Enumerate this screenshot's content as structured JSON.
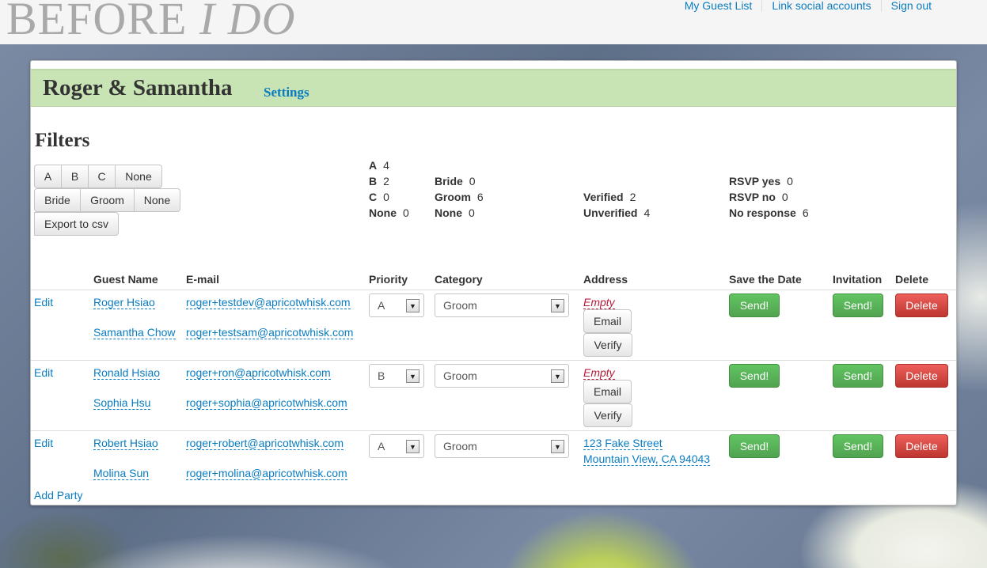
{
  "header": {
    "logo_main": "BEFORE",
    "logo_italic": "I DO",
    "nav": [
      "My Guest List",
      "Link social accounts",
      "Sign out"
    ]
  },
  "panel": {
    "title": "Roger & Samantha",
    "settings_label": "Settings",
    "filters_title": "Filters",
    "priority_buttons": [
      "A",
      "B",
      "C",
      "None"
    ],
    "category_buttons": [
      "Bride",
      "Groom",
      "None"
    ],
    "export_label": "Export to csv"
  },
  "stats": {
    "priority": [
      {
        "label": "A",
        "value": "4"
      },
      {
        "label": "B",
        "value": "2"
      },
      {
        "label": "C",
        "value": "0"
      },
      {
        "label": "None",
        "value": "0"
      }
    ],
    "category": [
      {
        "label": "Bride",
        "value": "0"
      },
      {
        "label": "Groom",
        "value": "6"
      },
      {
        "label": "None",
        "value": "0"
      }
    ],
    "verification": [
      {
        "label": "Verified",
        "value": "2"
      },
      {
        "label": "Unverified",
        "value": "4"
      }
    ],
    "rsvp": [
      {
        "label": "RSVP yes",
        "value": "0"
      },
      {
        "label": "RSVP no",
        "value": "0"
      },
      {
        "label": "No response",
        "value": "6"
      }
    ]
  },
  "table": {
    "headers": [
      "Guest Name",
      "E-mail",
      "Priority",
      "Category",
      "Address",
      "Save the Date",
      "Invitation",
      "Delete"
    ],
    "edit_label": "Edit",
    "empty_label": "Empty",
    "email_btn": "Email",
    "verify_btn": "Verify",
    "send_label": "Send!",
    "delete_label": "Delete",
    "add_party_label": "Add Party",
    "parties": [
      {
        "guests": [
          {
            "name": "Roger Hsiao",
            "email": "roger+testdev@apricotwhisk.com"
          },
          {
            "name": "Samantha Chow",
            "email": "roger+testsam@apricotwhisk.com"
          }
        ],
        "priority": "A",
        "category": "Groom",
        "address": null
      },
      {
        "guests": [
          {
            "name": "Ronald Hsiao",
            "email": "roger+ron@apricotwhisk.com"
          },
          {
            "name": "Sophia Hsu",
            "email": "roger+sophia@apricotwhisk.com"
          }
        ],
        "priority": "B",
        "category": "Groom",
        "address": null
      },
      {
        "guests": [
          {
            "name": "Robert Hsiao",
            "email": "roger+robert@apricotwhisk.com"
          },
          {
            "name": "Molina Sun",
            "email": "roger+molina@apricotwhisk.com"
          }
        ],
        "priority": "A",
        "category": "Groom",
        "address": {
          "line1": "123 Fake Street",
          "line2": "Mountain View, CA 94043"
        }
      }
    ]
  },
  "colors": {
    "link": "#0a7cc1",
    "header_band": "#c8e4b4",
    "send_green": "#51a351",
    "delete_red": "#bd362f",
    "empty_red": "#b71d3b"
  }
}
